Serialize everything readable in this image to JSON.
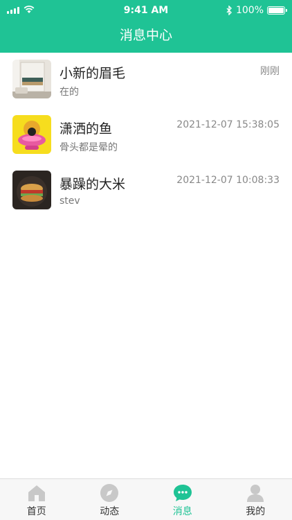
{
  "status_bar": {
    "time": "9:41 AM",
    "battery": "100%"
  },
  "header": {
    "title": "消息中心"
  },
  "messages": [
    {
      "name": "小新的眉毛",
      "preview": "在的",
      "time": "刚刚"
    },
    {
      "name": "潇洒的鱼",
      "preview": "骨头都是晕的",
      "time": "2021-12-07 15:38:05"
    },
    {
      "name": "暴躁的大米",
      "preview": "stev",
      "time": "2021-12-07 10:08:33"
    }
  ],
  "tabbar": {
    "tabs": [
      {
        "label": "首页",
        "icon": "home-icon"
      },
      {
        "label": "动态",
        "icon": "compass-icon"
      },
      {
        "label": "消息",
        "icon": "chat-bubble-icon",
        "active": true
      },
      {
        "label": "我的",
        "icon": "person-icon"
      }
    ]
  },
  "colors": {
    "accent": "#1fc395",
    "tab_inactive": "#c8c8c8"
  }
}
